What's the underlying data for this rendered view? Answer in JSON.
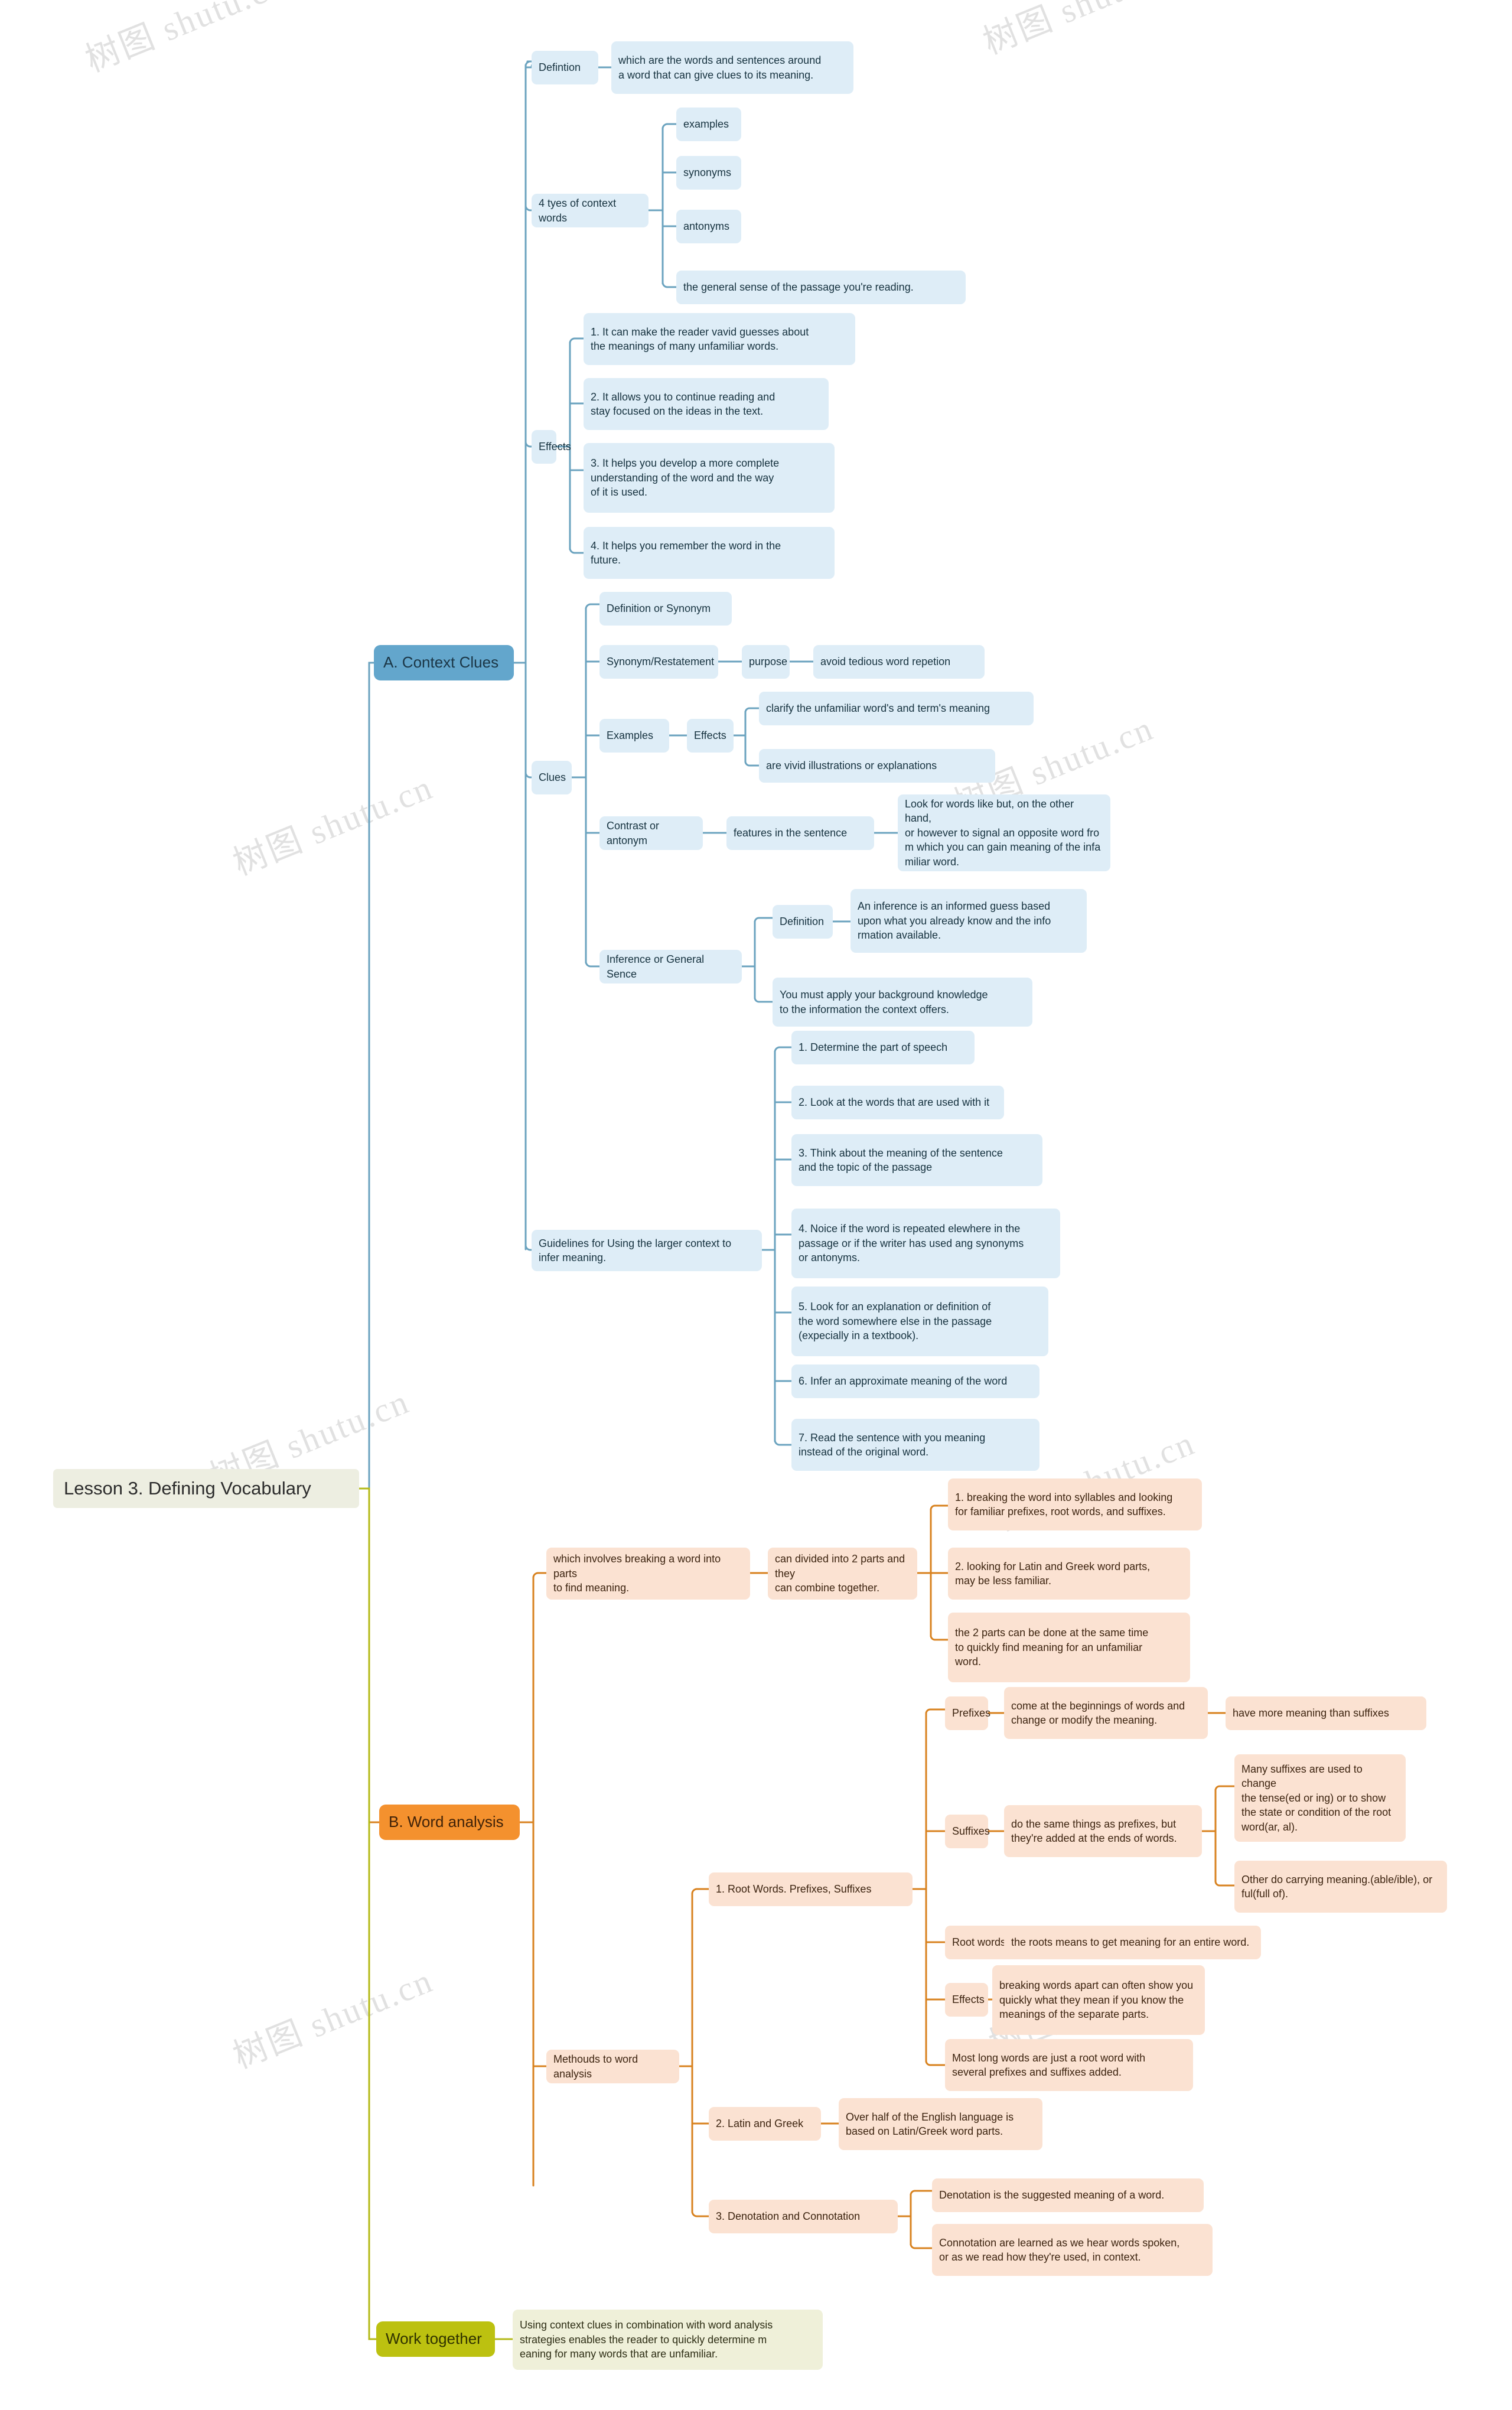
{
  "title": "Lesson 3. Defining Vocabulary",
  "watermark": "树图 shutu.cn",
  "colors": {
    "root_bg": "#edeee1",
    "branch_blue": "#63a6cc",
    "branch_orange": "#f4912e",
    "branch_olive": "#bcc110",
    "node_blue": "#deedf7",
    "node_orange": "#fbe2d2",
    "node_olive": "#eff0d9",
    "link_blue": "#6ba3bf",
    "link_orange": "#d8821f",
    "link_olive": "#b4ba18"
  },
  "root": {
    "label": "Lesson 3. Defining Vocabulary"
  },
  "branches": {
    "context_clues": {
      "label": "A. Context Clues"
    },
    "word_analysis": {
      "label": "B. Word analysis"
    },
    "work_together": {
      "label": "Work together"
    }
  },
  "nodes": {
    "definition": "Defintion",
    "definition_text": "which are the words and sentences around\na word that can give clues to its meaning.",
    "four_types": "4 tyes of context words",
    "four_types_items": [
      "examples",
      "synonyms",
      "antonyms",
      "the general sense of the passage you're reading."
    ],
    "effects": "Effects",
    "effects_items": [
      "1. It can make the reader vavid guesses about\nthe meanings of many unfamiliar words.",
      "2. It allows you to continue reading and\nstay focused on the ideas in the text.",
      "3. It helps you develop a more complete\nunderstanding of the word and the way\nof it is used.",
      "4. It helps you remember the word in the\nfuture."
    ],
    "clues": "Clues",
    "clue_definition_or_synonym": "Definition or Synonym",
    "clue_synonym_restatement": "Synonym/Restatement",
    "clue_purpose": "purpose",
    "clue_purpose_text": "avoid tedious word repetion",
    "clue_examples": "Examples",
    "clue_examples_effects": "Effects",
    "clue_examples_effects_items": [
      "clarify the unfamiliar word's and term's meaning",
      "are vivid illustrations or explanations"
    ],
    "clue_contrast": "Contrast or antonym",
    "clue_contrast_features": "features in the sentence",
    "clue_contrast_text": "Look for words like but, on the other hand,\n or however to signal an opposite word fro\nm which you can gain meaning of the infa\nmiliar word.",
    "clue_inference": "Inference or General Sence",
    "clue_inference_definition": "Definition",
    "clue_inference_definition_text": "An inference is an informed guess based\nupon what you already know and the info\nrmation available.",
    "clue_inference_apply": "You must apply your background knowledge\n to the information the context offers.",
    "guidelines": "Guidelines for Using the larger context to\ninfer meaning.",
    "guideline_items": [
      "1. Determine the part of speech",
      "2. Look at the words that are used with it",
      "3. Think about the meaning of the sentence\n and the topic of the passage",
      "4. Noice if the word is repeated elewhere in the\npassage or if the writer has used ang synonyms\n or antonyms.",
      "5. Look for an explanation or definition of\n the word somewhere else in the passage\n(expecially in a textbook).",
      "6. Infer an approximate meaning of the word",
      "7. Read the sentence with you meaning\ninstead of the original word."
    ],
    "wa_involves": "which involves breaking a word into parts\n to find meaning.",
    "wa_divided": "can divided into 2 parts and they\n can combine together.",
    "wa_divided_items": [
      "1. breaking the word into syllables and looking\nfor familiar prefixes, root words, and suffixes.",
      "2. looking for Latin and Greek word parts,\nmay be less familiar.",
      "the 2 parts can be done at the same time\nto quickly find meaning for an unfamiliar\nword."
    ],
    "wa_methods": "Methouds to word analysis",
    "wa_m1": "1. Root Words. Prefixes, Suffixes",
    "wa_prefixes": "Prefixes",
    "wa_prefixes_text": "come at the beginnings of words and\n change or modify the meaning.",
    "wa_prefixes_more": "have more meaning than suffixes",
    "wa_suffixes": "Suffixes",
    "wa_suffixes_text": "do the same things as prefixes, but\nthey're added at the ends of words.",
    "wa_suffixes_items": [
      "Many suffixes are used to change\nthe tense(ed or ing) or to show\nthe state or condition of the root\n word(ar, al).",
      "Other do carrying meaning.(able/ible), or\nful(full of)."
    ],
    "wa_root_words": "Root words",
    "wa_root_words_text": "the roots means to get meaning for an entire word.",
    "wa_effects": "Effects",
    "wa_effects_text": "breaking words apart can often show you\n quickly what they mean if you know the\nmeanings of the separate parts.",
    "wa_most_long": "Most long words are just a root word with\n several prefixes and suffixes added.",
    "wa_m2": "2. Latin and Greek",
    "wa_m2_text": "Over half of the English language is\nbased on Latin/Greek word parts.",
    "wa_m3": "3. Denotation and Connotation",
    "wa_m3_items": [
      "Denotation is the suggested meaning of a word.",
      "Connotation are learned as we hear words spoken,\n or as we read how they're used, in context."
    ],
    "wt_text": "Using context clues in combination with word analysis\n strategies enables the reader to quickly determine m\neaning for many words that are unfamiliar."
  }
}
